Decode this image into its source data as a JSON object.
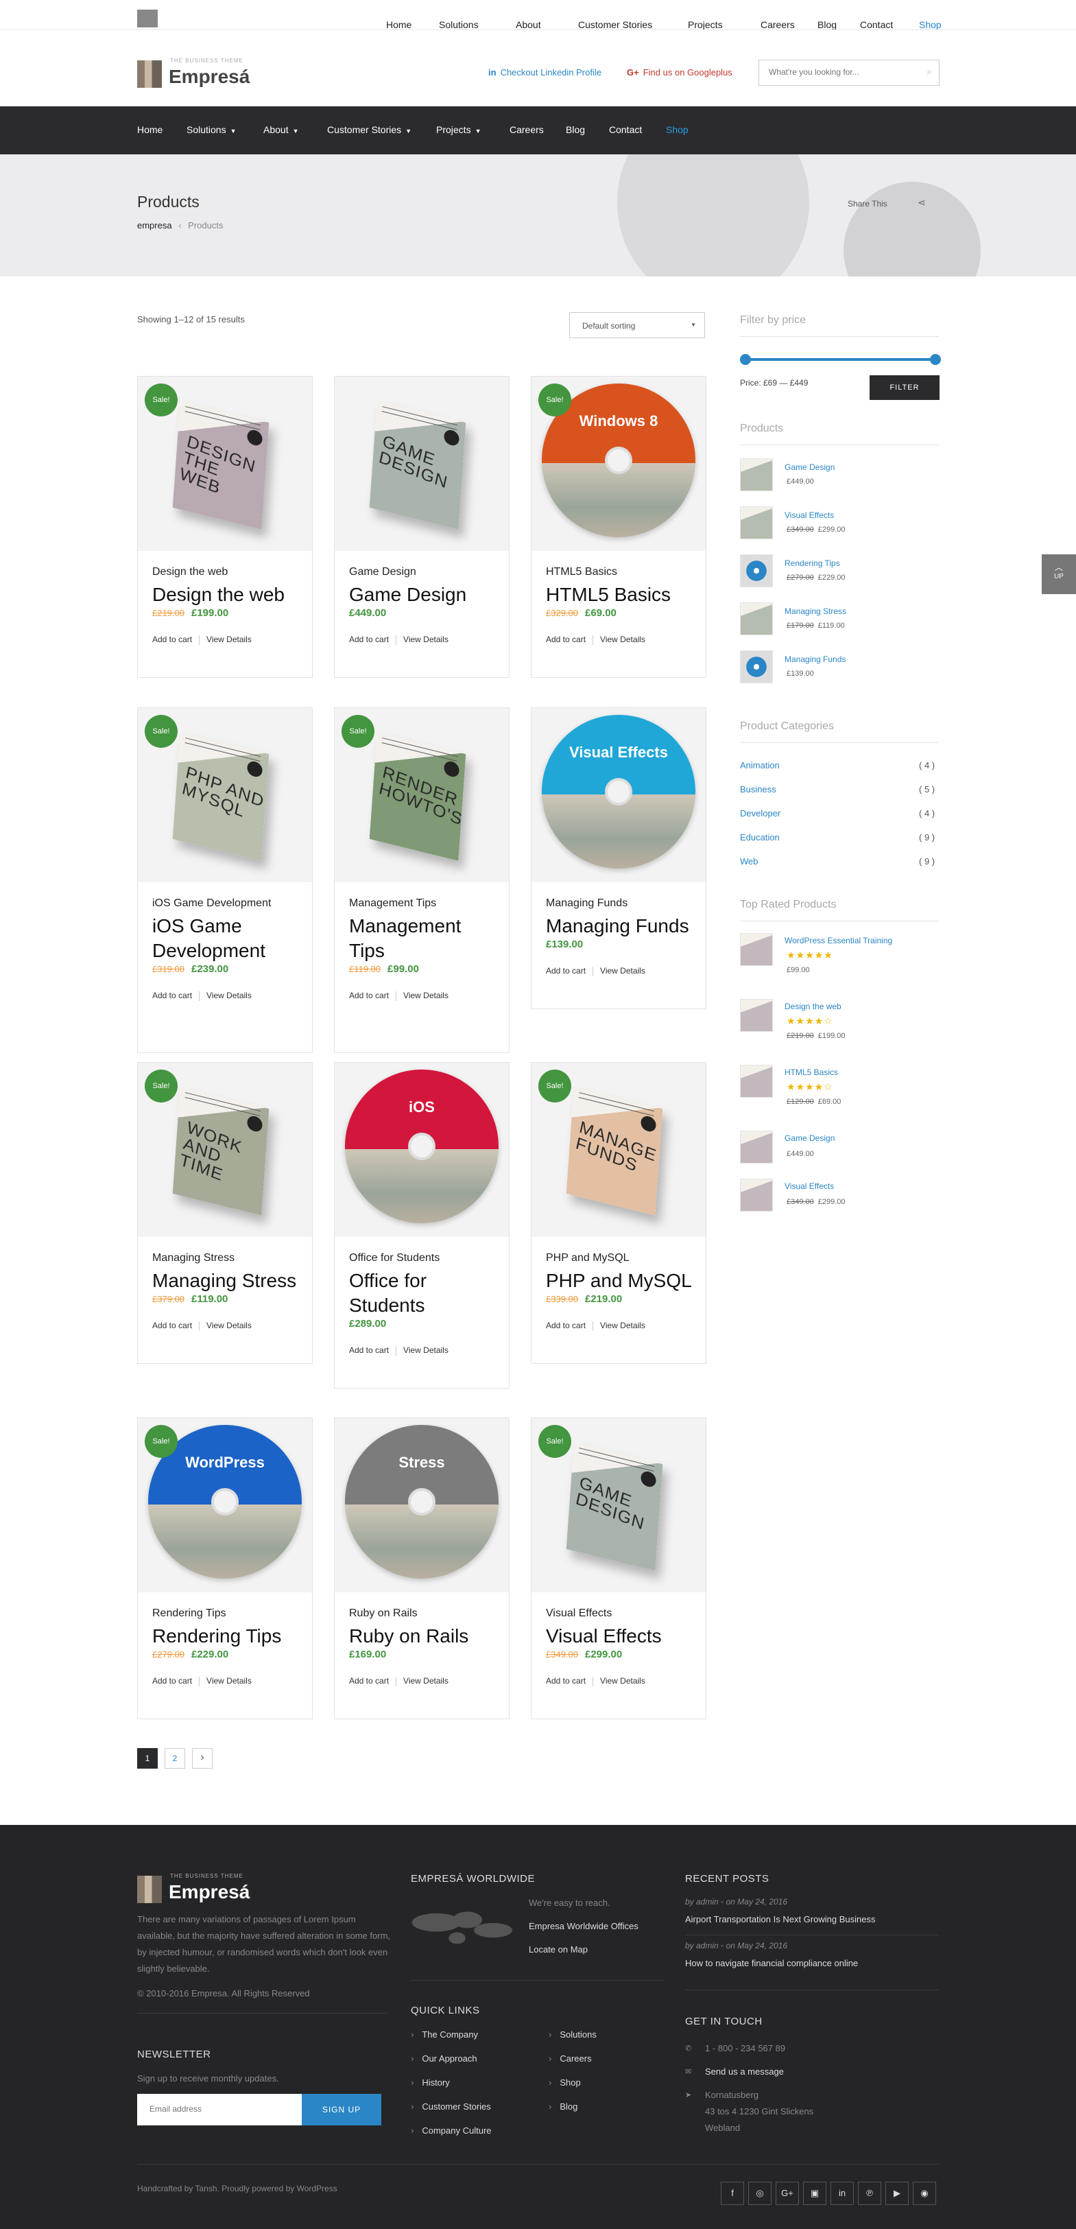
{
  "ghost_header": {
    "nav": [
      "Home",
      "Solutions",
      "About",
      "Customer Stories",
      "Projects",
      "Careers",
      "Blog",
      "Contact",
      "Shop"
    ]
  },
  "brand": {
    "tagline": "THE BUSINESS THEME",
    "name": "Empresá"
  },
  "topbar": {
    "linkedin": "Checkout Linkedin Profile",
    "googleplus": "Find us on Googleplus",
    "search_placeholder": "What're you looking for..."
  },
  "nav": {
    "items": [
      "Home",
      "Solutions",
      "About",
      "Customer Stories",
      "Projects",
      "Careers",
      "Blog",
      "Contact",
      "Shop"
    ]
  },
  "hero": {
    "title": "Products",
    "crumb_home": "empresa",
    "crumb_current": "Products",
    "share": "Share This"
  },
  "shop": {
    "result_count": "Showing 1–12 of 15 results",
    "sorting": "Default sorting",
    "sale_label": "Sale!",
    "add_to_cart": "Add to cart",
    "view_details": "View Details"
  },
  "products": [
    {
      "cat": "Design the web",
      "name": "Design the web",
      "old": "£219.00",
      "price": "£199.00",
      "sale": true,
      "art": "book",
      "book_text": "DESIGN THE WEB",
      "color": "#b9a9b3"
    },
    {
      "cat": "Game Design",
      "name": "Game Design",
      "old": "",
      "price": "£449.00",
      "sale": false,
      "art": "book",
      "book_text": "GAME DESIGN",
      "color": "#a9b4ad"
    },
    {
      "cat": "HTML5 Basics",
      "name": "HTML5 Basics",
      "old": "£329.00",
      "price": "£69.00",
      "sale": true,
      "art": "disc",
      "disc_text": "Windows 8",
      "color": "#d9531e"
    },
    {
      "cat": "iOS Game Development",
      "name": "iOS Game Development",
      "old": "£319.00",
      "price": "£239.00",
      "sale": true,
      "art": "book",
      "book_text": "PHP AND MYSQL",
      "color": "#b8c0ad"
    },
    {
      "cat": "Management Tips",
      "name": "Management Tips",
      "old": "£119.00",
      "price": "£99.00",
      "sale": true,
      "art": "book",
      "book_text": "RENDER HOWTO'S",
      "color": "#7f9a74"
    },
    {
      "cat": "Managing Funds",
      "name": "Managing Funds",
      "old": "",
      "price": "£139.00",
      "sale": false,
      "art": "disc",
      "disc_text": "Visual Effects",
      "color": "#20a7d8"
    },
    {
      "cat": "Managing Stress",
      "name": "Managing Stress",
      "old": "£379.00",
      "price": "£119.00",
      "sale": true,
      "art": "book",
      "book_text": "WORK AND TIME",
      "color": "#a6ab98"
    },
    {
      "cat": "Office for Students",
      "name": "Office for Students",
      "old": "",
      "price": "£289.00",
      "sale": false,
      "art": "disc",
      "disc_text": "iOS",
      "color": "#d3163c"
    },
    {
      "cat": "PHP and MySQL",
      "name": "PHP and MySQL",
      "old": "£339.00",
      "price": "£219.00",
      "sale": true,
      "art": "book",
      "book_text": "MANAGE FUNDS",
      "color": "#e3c0a3"
    },
    {
      "cat": "Rendering Tips",
      "name": "Rendering Tips",
      "old": "£279.00",
      "price": "£229.00",
      "sale": true,
      "art": "disc",
      "disc_text": "WordPress",
      "color": "#1b63c7"
    },
    {
      "cat": "Ruby on Rails",
      "name": "Ruby on Rails",
      "old": "",
      "price": "£169.00",
      "sale": false,
      "art": "disc",
      "disc_text": "Stress",
      "color": "#7c7c7c"
    },
    {
      "cat": "Visual Effects",
      "name": "Visual Effects",
      "old": "£349.00",
      "price": "£299.00",
      "sale": true,
      "art": "book",
      "book_text": "GAME DESIGN",
      "color": "#a9b4ad"
    }
  ],
  "pagination": {
    "pages": [
      "1",
      "2"
    ],
    "next": "›"
  },
  "sidebar": {
    "filter": {
      "title": "Filter by price",
      "label": "Price: £69 — £449",
      "button": "FILTER"
    },
    "products": {
      "title": "Products",
      "items": [
        {
          "name": "Game Design",
          "old": "",
          "price": "£449.00",
          "art": "book"
        },
        {
          "name": "Visual Effects",
          "old": "£349.00",
          "price": "£299.00",
          "art": "book"
        },
        {
          "name": "Rendering Tips",
          "old": "£279.00",
          "price": "£229.00",
          "art": "disc"
        },
        {
          "name": "Managing Stress",
          "old": "£179.00",
          "price": "£119.00",
          "art": "book"
        },
        {
          "name": "Managing Funds",
          "old": "",
          "price": "£139.00",
          "art": "disc"
        }
      ]
    },
    "categories": {
      "title": "Product Categories",
      "items": [
        {
          "name": "Animation",
          "count": "( 4 )"
        },
        {
          "name": "Business",
          "count": "( 5 )"
        },
        {
          "name": "Developer",
          "count": "( 4 )"
        },
        {
          "name": "Education",
          "count": "( 9 )"
        },
        {
          "name": "Web",
          "count": "( 9 )"
        }
      ]
    },
    "top_rated": {
      "title": "Top Rated Products",
      "items": [
        {
          "name": "WordPress Essential Training",
          "old": "",
          "price": "£99.00",
          "rating": 5
        },
        {
          "name": "Design the web",
          "old": "£219.00",
          "price": "£199.00",
          "rating": 4
        },
        {
          "name": "HTML5 Basics",
          "old": "£129.00",
          "price": "£69.00",
          "rating": 4
        },
        {
          "name": "Game Design",
          "old": "",
          "price": "£449.00",
          "rating": 0
        },
        {
          "name": "Visual Effects",
          "old": "£349.00",
          "price": "£299.00",
          "rating": 0
        }
      ]
    }
  },
  "up_button": "UP",
  "footer": {
    "about": "There are many variations of passages of Lorem Ipsum available, but the majority have suffered alteration in some form, by injected humour, or randomised words which don't look even slightly believable.",
    "copyright": "© 2010-2016 Empresa. All Rights Reserved",
    "newsletter_title": "NEWSLETTER",
    "newsletter_text": "Sign up to receive monthly updates.",
    "email_placeholder": "Email address",
    "signup": "SIGN UP",
    "worldwide_title": "EMPRESÁ WORLDWIDE",
    "worldwide_lines": [
      "We're easy to reach.",
      "Empresa Worldwide Offices",
      "Locate on Map"
    ],
    "quick_links_title": "QUICK LINKS",
    "quick_links": [
      "The Company",
      "Our Approach",
      "History",
      "Customer Stories",
      "Company Culture",
      "Solutions",
      "Careers",
      "Shop",
      "Blog"
    ],
    "recent_title": "RECENT POSTS",
    "posts": [
      {
        "meta": "by admin  ◦  on May 24, 2016",
        "title": "Airport Transportation Is Next Growing Business"
      },
      {
        "meta": "by admin  ◦  on May 24, 2016",
        "title": "How to navigate financial compliance online"
      }
    ],
    "touch_title": "GET IN TOUCH",
    "phone": "1 - 800 - 234 567 89",
    "message": "Send us a message",
    "address": [
      "Kornatusberg",
      "43 tos 4 1230 Gint Slickens",
      "Webland"
    ],
    "credits": "Handcrafted by Tansh. Proudly powered by WordPress",
    "social": [
      "f",
      "◎",
      "G+",
      "▣",
      "in",
      "℗",
      "▶",
      "◉"
    ]
  }
}
